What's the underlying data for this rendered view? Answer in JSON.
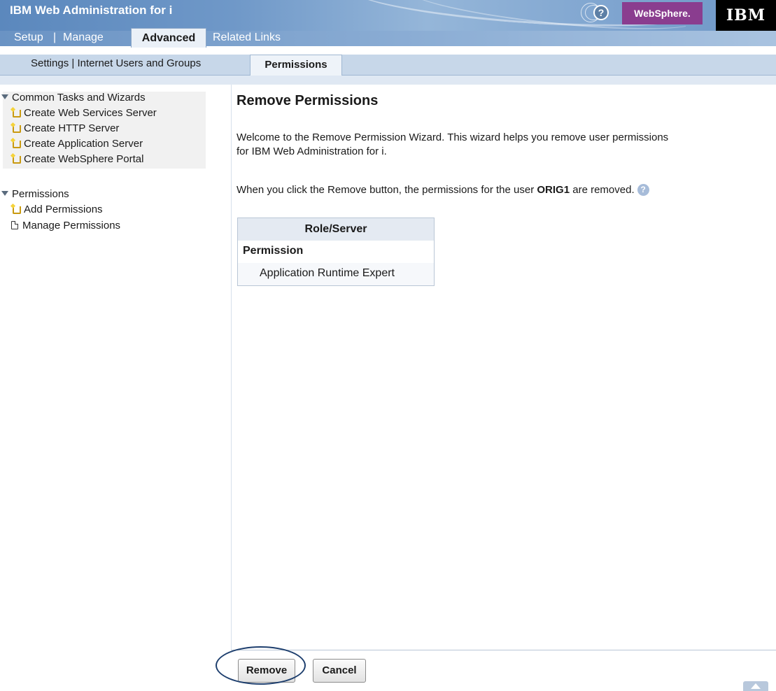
{
  "header": {
    "app_title": "IBM Web Administration for i",
    "nav": [
      {
        "label": "Setup"
      },
      {
        "label": "Manage"
      },
      {
        "label": "Advanced",
        "active": true
      },
      {
        "label": "Related Links"
      }
    ],
    "help_icon": "question-icon",
    "websphere_label": "WebSphere.",
    "ibm_logo": "IBM"
  },
  "subnav": {
    "items": [
      {
        "label": "Settings"
      },
      {
        "label": "Internet Users and Groups"
      },
      {
        "label": "Permissions",
        "active": true
      }
    ]
  },
  "sidebar": {
    "groups": [
      {
        "title": "Common Tasks and Wizards",
        "items": [
          {
            "label": "Create Web Services Server",
            "icon": "wizard-icon"
          },
          {
            "label": "Create HTTP Server",
            "icon": "wizard-icon"
          },
          {
            "label": "Create Application Server",
            "icon": "wizard-icon"
          },
          {
            "label": "Create WebSphere Portal",
            "icon": "wizard-icon"
          }
        ]
      },
      {
        "title": "Permissions",
        "items": [
          {
            "label": "Add Permissions",
            "icon": "wizard-icon"
          },
          {
            "label": "Manage Permissions",
            "icon": "page-icon"
          }
        ]
      }
    ]
  },
  "main": {
    "title": "Remove Permissions",
    "intro_line1": "Welcome to the Remove Permission Wizard. This wizard helps you remove user permissions",
    "intro_line2": "for IBM Web Administration for i.",
    "remove_text_before": "When you click the Remove button, the permissions for the user",
    "user": "ORIG1",
    "remove_text_after": "are removed.",
    "table": {
      "header": "Role/Server",
      "group": "Permission",
      "rows": [
        "Application Runtime Expert"
      ]
    }
  },
  "footer": {
    "remove_label": "Remove",
    "cancel_label": "Cancel"
  },
  "colors": {
    "banner": "#6f98c8",
    "websphere": "#8a3d8f",
    "highlight_ring": "#1e3f6e"
  }
}
